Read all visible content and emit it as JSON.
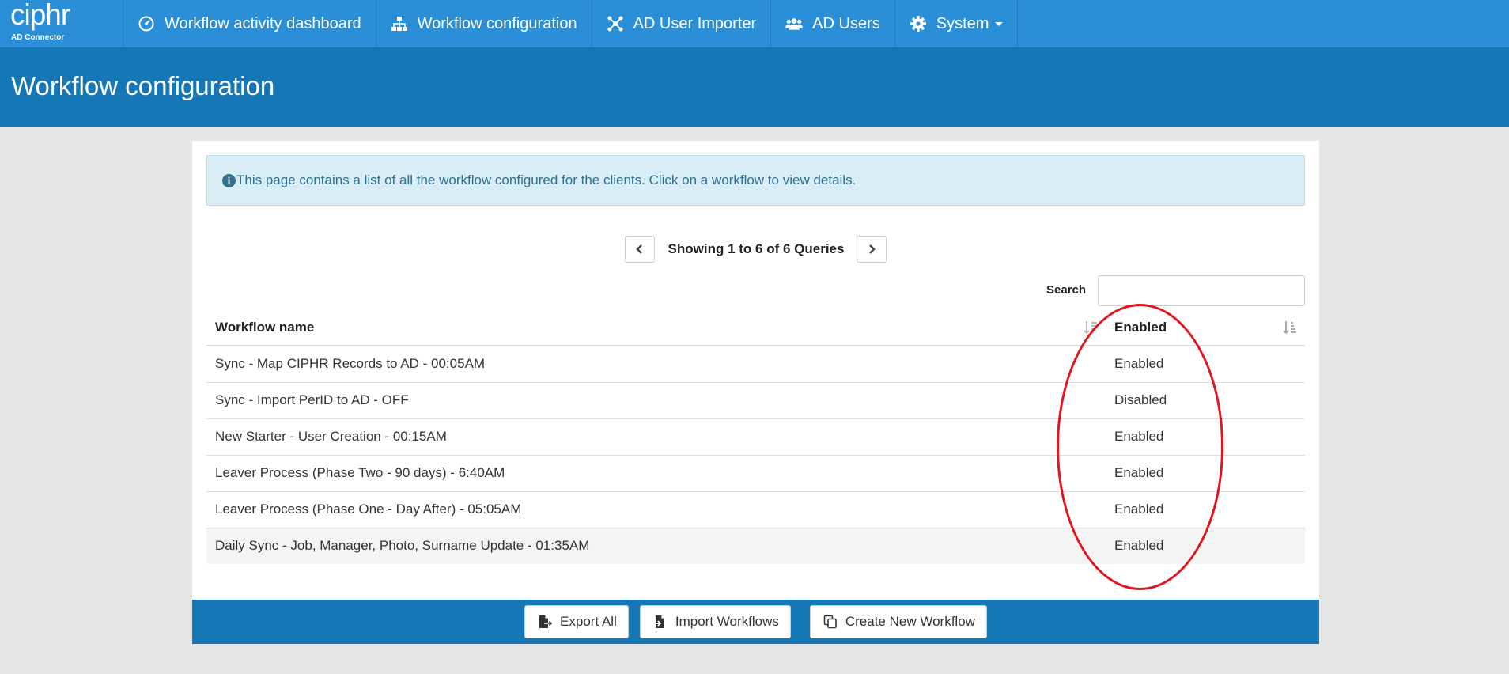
{
  "brand": {
    "logo": "ciphr",
    "subtitle": "AD Connector"
  },
  "nav": {
    "items": [
      {
        "label": "Workflow activity dashboard",
        "icon": "dashboard-icon"
      },
      {
        "label": "Workflow configuration",
        "icon": "sitemap-icon"
      },
      {
        "label": "AD User Importer",
        "icon": "network-icon"
      },
      {
        "label": "AD Users",
        "icon": "users-icon"
      },
      {
        "label": "System",
        "icon": "gear-icon",
        "dropdown": true
      }
    ]
  },
  "header": {
    "title": "Workflow configuration"
  },
  "info": {
    "text": "This page contains a list of all the workflow configured for the clients. Click on a workflow to view details."
  },
  "pager": {
    "text": "Showing 1 to 6 of 6 Queries"
  },
  "search": {
    "label": "Search",
    "value": "",
    "placeholder": ""
  },
  "table": {
    "headers": [
      "Workflow name",
      "Enabled"
    ],
    "rows": [
      {
        "name": "Sync - Map CIPHR Records to AD - 00:05AM",
        "status": "Enabled"
      },
      {
        "name": "Sync - Import PerID to AD - OFF",
        "status": "Disabled"
      },
      {
        "name": "New Starter - User Creation - 00:15AM",
        "status": "Enabled"
      },
      {
        "name": "Leaver Process (Phase Two - 90 days) - 6:40AM",
        "status": "Enabled"
      },
      {
        "name": "Leaver Process (Phase One - Day After) - 05:05AM",
        "status": "Enabled"
      },
      {
        "name": "Daily Sync - Job, Manager, Photo, Surname Update - 01:35AM",
        "status": "Enabled"
      }
    ]
  },
  "footer": {
    "export_label": "Export All",
    "import_label": "Import Workflows",
    "create_label": "Create New Workflow"
  },
  "colors": {
    "nav_bg": "#2a8fd6",
    "header_bg": "#1577b6",
    "annotation": "#e0161e"
  }
}
